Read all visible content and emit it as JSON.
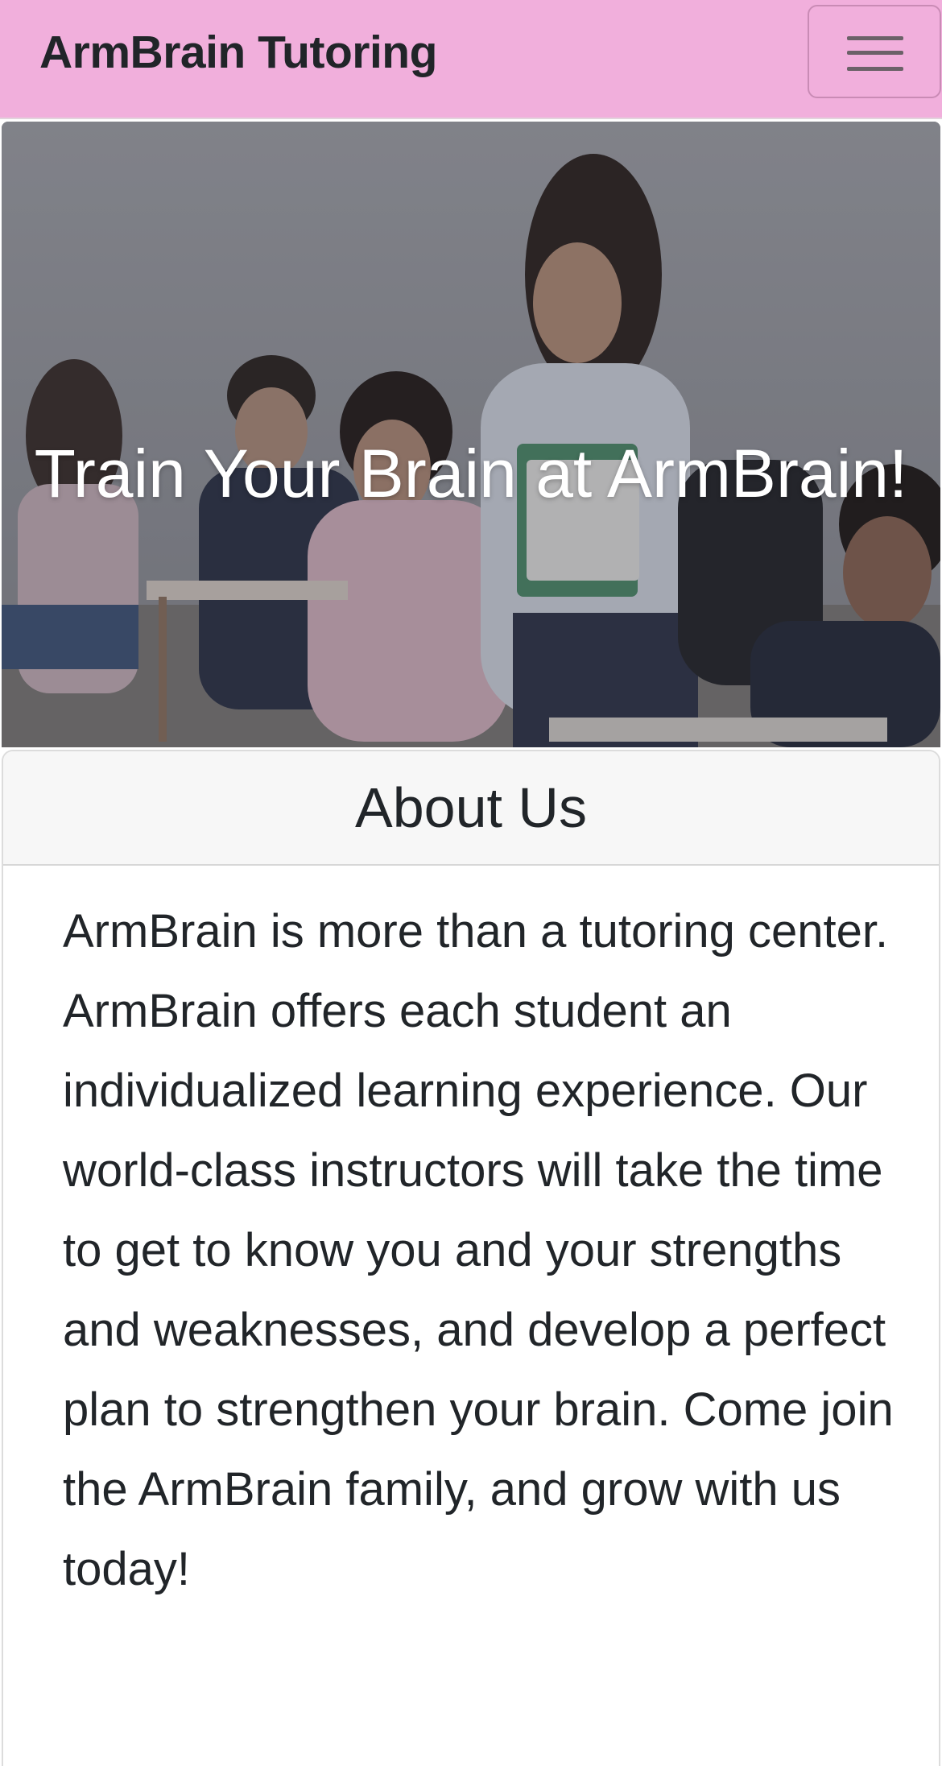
{
  "navbar": {
    "brand": "ArmBrain Tutoring",
    "toggle_icon": "hamburger-menu-icon",
    "background_color": "#f1afdc"
  },
  "hero": {
    "title": "Train Your Brain at ArmBrain!",
    "image_description": "photo-of-students-in-classroom"
  },
  "about": {
    "heading": "About Us",
    "body": "ArmBrain is more than a tutoring center. ArmBrain offers each student an individualized learning experience. Our world-class instructors will take the time to get to know you and your strengths and weaknesses, and develop a perfect plan to strengthen your brain. Come join the ArmBrain family, and grow with us today!"
  }
}
